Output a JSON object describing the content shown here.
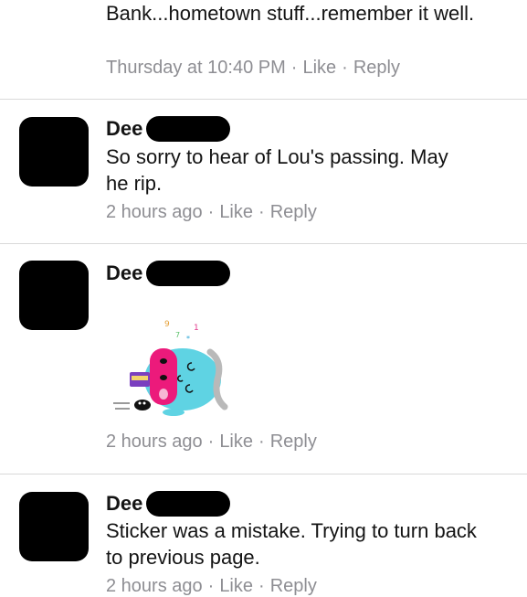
{
  "comments": [
    {
      "text": "Bank...hometown stuff...remember it well.",
      "time": "Thursday at 10:40 PM",
      "like": "Like",
      "reply": "Reply"
    },
    {
      "name": "Dee",
      "text": "So sorry to hear of Lou's passing. May he rip.",
      "time": "2 hours ago",
      "like": "Like",
      "reply": "Reply"
    },
    {
      "name": "Dee",
      "sticker": "cartoon-sticker",
      "time": "2 hours ago",
      "like": "Like",
      "reply": "Reply"
    },
    {
      "name": "Dee",
      "text": "Sticker was a mistake. Trying to turn back to previous page.",
      "time": "2 hours ago",
      "like": "Like",
      "reply": "Reply"
    }
  ],
  "separator": "·",
  "colors": {
    "meta": "#8e8e93",
    "divider": "#d9d9d9"
  }
}
